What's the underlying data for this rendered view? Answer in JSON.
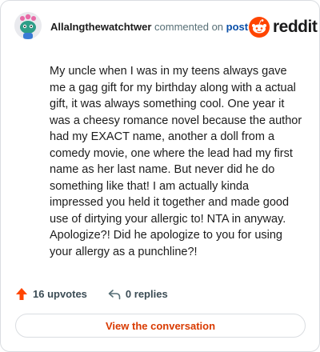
{
  "header": {
    "username": "AllaIngthewatchtwer",
    "commented_on": "commented on",
    "post_link": "post"
  },
  "brand": {
    "name": "reddit",
    "logo_icon": "reddit-snoo-icon",
    "color": "#ff4500"
  },
  "comment": {
    "text": "My uncle when I was in my teens always gave me a gag gift for my birthday along with a actual gift, it was always something cool. One year it was a cheesy romance novel because the author had my EXACT name, another a doll from a comedy movie, one where the lead had my first name as her last name. But never did he do something like that! I am actually kinda impressed you held it together and made good use of dirtying your allergic to! NTA in anyway. Apologize?! Did he apologize to you for using your allergy as a punchline?!"
  },
  "footer": {
    "upvotes": "16 upvotes",
    "upvote_icon": "upvote-arrow-icon",
    "upvote_color": "#ff4500",
    "replies": "0 replies",
    "reply_icon": "reply-arrow-icon"
  },
  "cta": {
    "label": "View the conversation",
    "color": "#d93a00"
  }
}
